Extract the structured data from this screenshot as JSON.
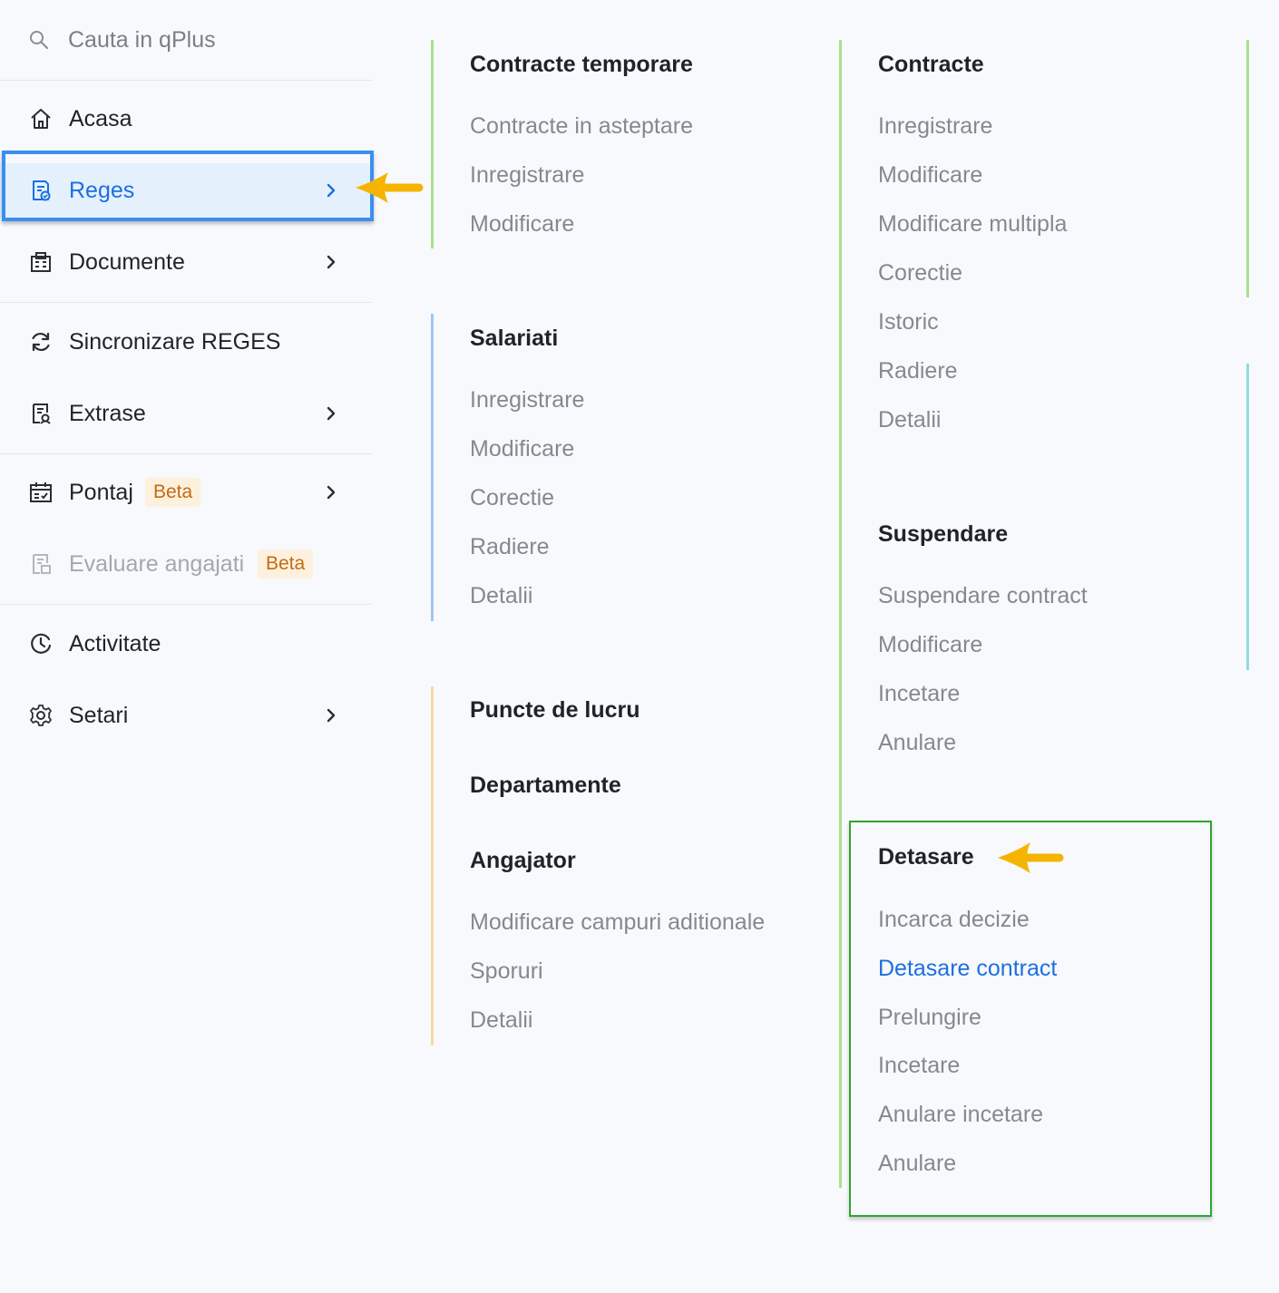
{
  "search": {
    "placeholder": "Cauta in qPlus"
  },
  "sidebar": {
    "items": [
      {
        "label": "Acasa",
        "icon": "home-icon"
      },
      {
        "label": "Reges",
        "icon": "reges-document-icon",
        "active": true
      },
      {
        "label": "Documente",
        "icon": "documents-icon"
      },
      {
        "label": "Sincronizare REGES",
        "icon": "sync-icon"
      },
      {
        "label": "Extrase",
        "icon": "extract-icon"
      },
      {
        "label": "Pontaj",
        "icon": "calendar-icon",
        "badge": "Beta"
      },
      {
        "label": "Evaluare angajati",
        "icon": "evaluation-icon",
        "badge": "Beta",
        "disabled": true
      },
      {
        "label": "Activitate",
        "icon": "activity-clock-icon"
      },
      {
        "label": "Setari",
        "icon": "settings-gear-icon"
      }
    ]
  },
  "menu": {
    "contracte_temporare": {
      "title": "Contracte temporare",
      "items": [
        "Contracte in asteptare",
        "Inregistrare",
        "Modificare"
      ]
    },
    "salariati": {
      "title": "Salariati",
      "items": [
        "Inregistrare",
        "Modificare",
        "Corectie",
        "Radiere",
        "Detalii"
      ]
    },
    "puncte_de_lucru": {
      "title": "Puncte de lucru"
    },
    "departamente": {
      "title": "Departamente"
    },
    "angajator": {
      "title": "Angajator",
      "items": [
        "Modificare campuri aditionale",
        "Sporuri",
        "Detalii"
      ]
    },
    "contracte": {
      "title": "Contracte",
      "items": [
        "Inregistrare",
        "Modificare",
        "Modificare multipla",
        "Corectie",
        "Istoric",
        "Radiere",
        "Detalii"
      ]
    },
    "suspendare": {
      "title": "Suspendare",
      "items": [
        "Suspendare contract",
        "Modificare",
        "Incetare",
        "Anulare"
      ]
    },
    "detasare": {
      "title": "Detasare",
      "items": [
        "Incarca decizie",
        "Detasare contract",
        "Prelungire",
        "Incetare",
        "Anulare incetare",
        "Anulare"
      ],
      "active_item": "Detasare contract"
    }
  },
  "colors": {
    "accent_blue": "#1d6fe0",
    "active_bg": "#e4f1fd",
    "highlight_frame": "#3b8ff0",
    "annotation_arrow": "#f5b400",
    "annotation_box": "#2ea52e",
    "line_green": "#a9e08e",
    "line_blue": "#9fc6f0",
    "line_orange": "#f8d9a0",
    "line_teal": "#8fdde0",
    "badge_text": "#c66a12",
    "badge_bg": "#fdf1de"
  }
}
